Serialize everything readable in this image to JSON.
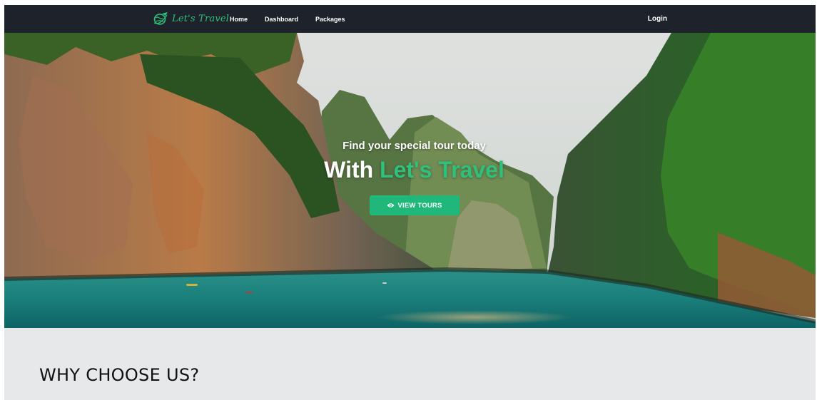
{
  "navbar": {
    "brand": {
      "text": "Let's Travel",
      "icon": "globe-plane-icon"
    },
    "links": [
      {
        "label": "Home"
      },
      {
        "label": "Dashboard"
      },
      {
        "label": "Packages"
      }
    ],
    "login_label": "Login"
  },
  "hero": {
    "subtitle": "Find your special tour today",
    "title_prefix": "With",
    "title_brand": "Let's Travel",
    "cta": {
      "label": "VIEW TOURS",
      "icon": "eye-icon"
    }
  },
  "section": {
    "title": "WHY CHOOSE US?"
  },
  "colors": {
    "navbar": "#1d222b",
    "accent": "#2ec27a",
    "button": "#1fb87a",
    "section_bg": "#e7e8ea"
  }
}
